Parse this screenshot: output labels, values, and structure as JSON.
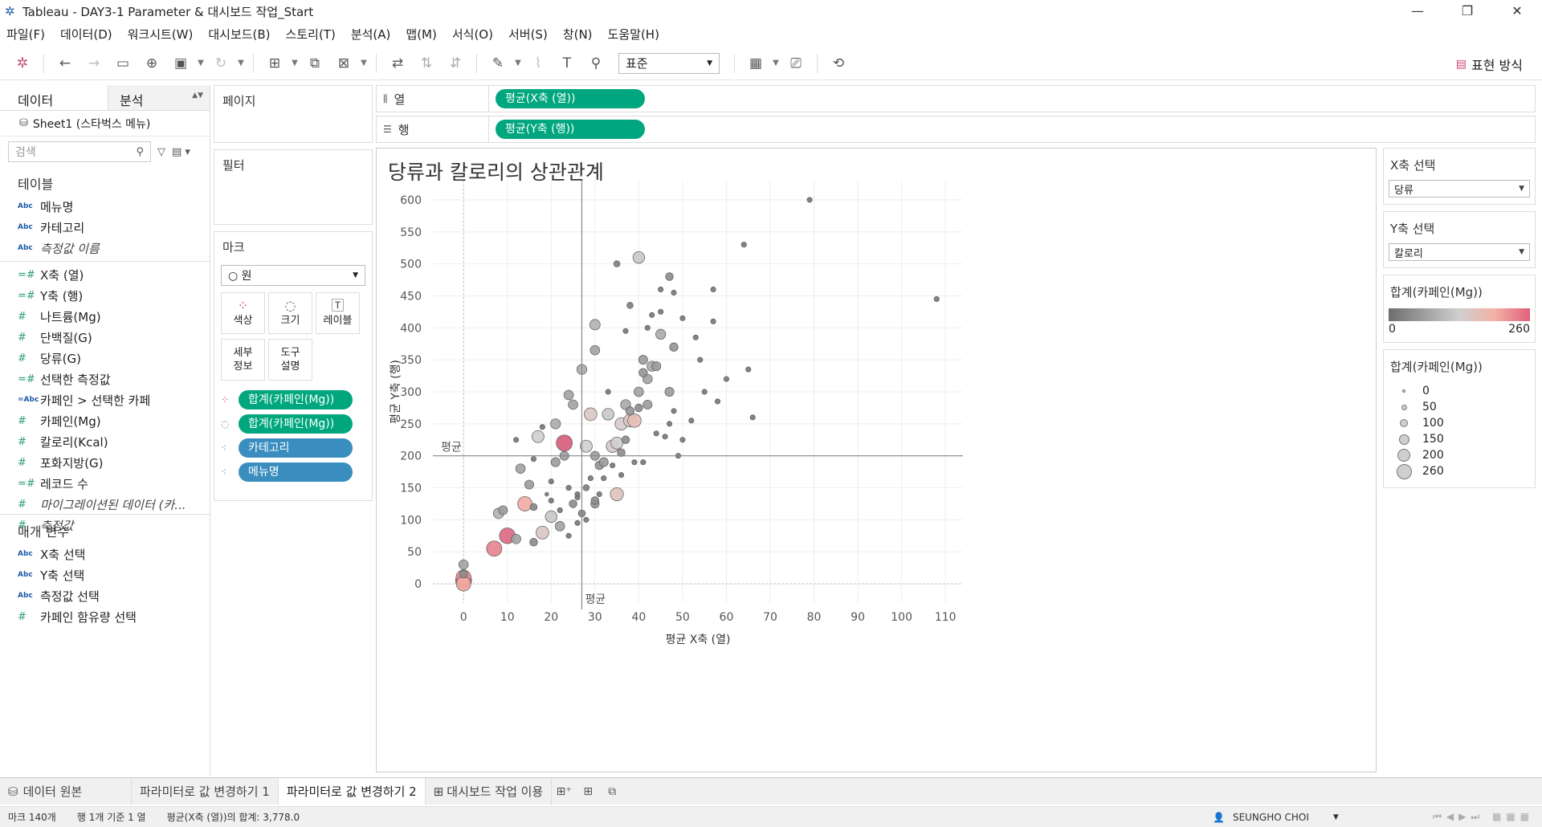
{
  "window": {
    "title": "Tableau - DAY3-1 Parameter & 대시보드 작업_Start"
  },
  "menu": [
    "파일(F)",
    "데이터(D)",
    "워크시트(W)",
    "대시보드(B)",
    "스토리(T)",
    "분석(A)",
    "맵(M)",
    "서식(O)",
    "서버(S)",
    "창(N)",
    "도움말(H)"
  ],
  "toolbar": {
    "view_size": "표준",
    "show_me": "표현 방식"
  },
  "left": {
    "tab_data": "데이터",
    "tab_analysis": "분석",
    "datasource": "Sheet1 (스타벅스 메뉴)",
    "search_placeholder": "검색",
    "tables_header": "테이블",
    "fields_dim": [
      {
        "icon": "Abc",
        "label": "메뉴명",
        "italic": false
      },
      {
        "icon": "Abc",
        "label": "카테고리",
        "italic": false
      },
      {
        "icon": "Abc",
        "label": "측정값 이름",
        "italic": true
      }
    ],
    "fields_meas": [
      {
        "icon": "=#",
        "label": "X축 (열)",
        "italic": false
      },
      {
        "icon": "=#",
        "label": "Y축 (행)",
        "italic": false
      },
      {
        "icon": "#",
        "label": "나트륨(Mg)",
        "italic": false
      },
      {
        "icon": "#",
        "label": "단백질(G)",
        "italic": false
      },
      {
        "icon": "#",
        "label": "당류(G)",
        "italic": false
      },
      {
        "icon": "=#",
        "label": "선택한 측정값",
        "italic": false
      },
      {
        "icon": "=Abc",
        "label": "카페인 > 선택한 카페",
        "italic": false
      },
      {
        "icon": "#",
        "label": "카페인(Mg)",
        "italic": false
      },
      {
        "icon": "#",
        "label": "칼로리(Kcal)",
        "italic": false
      },
      {
        "icon": "#",
        "label": "포화지방(G)",
        "italic": false
      },
      {
        "icon": "=#",
        "label": "레코드 수",
        "italic": false
      },
      {
        "icon": "#",
        "label": "마이그레이션된 데이터 (카...",
        "italic": true
      },
      {
        "icon": "#",
        "label": "측정값",
        "italic": true
      }
    ],
    "params_header": "매개 변수",
    "params": [
      {
        "icon": "Abc",
        "label": "X축 선택"
      },
      {
        "icon": "Abc",
        "label": "Y축 선택"
      },
      {
        "icon": "Abc",
        "label": "측정값 선택"
      },
      {
        "icon": "#",
        "label": "카페인 함유량 선택"
      }
    ]
  },
  "cards": {
    "pages": "페이지",
    "filters": "필터",
    "marks": "마크",
    "mark_type": "원",
    "mark_buttons": [
      {
        "icon": "color-icon",
        "label": "색상"
      },
      {
        "icon": "size-icon",
        "label": "크기"
      },
      {
        "icon": "label-icon",
        "label": "레이블"
      },
      {
        "icon": "",
        "label": "세부\n정보"
      },
      {
        "icon": "",
        "label": "도구\n설명"
      }
    ],
    "mark_pills": [
      {
        "icon": "color",
        "label": "합계(카페인(Mg))",
        "color": "green"
      },
      {
        "icon": "size",
        "label": "합계(카페인(Mg))",
        "color": "green"
      },
      {
        "icon": "detail",
        "label": "카테고리",
        "color": "blue"
      },
      {
        "icon": "detail",
        "label": "메뉴명",
        "color": "blue"
      }
    ]
  },
  "shelves": {
    "columns_label": "열",
    "columns_pill": "평균(X축 (열))",
    "rows_label": "행",
    "rows_pill": "평균(Y축 (행))"
  },
  "right": {
    "x_sel_title": "X축 선택",
    "x_sel_value": "당류",
    "y_sel_title": "Y축 선택",
    "y_sel_value": "칼로리",
    "color_legend_title": "합계(카페인(Mg))",
    "color_min": "0",
    "color_max": "260",
    "size_legend_title": "합계(카페인(Mg))",
    "size_legend": [
      "0",
      "50",
      "100",
      "150",
      "200",
      "260"
    ]
  },
  "chart_data": {
    "type": "scatter",
    "title": "당류과 칼로리의 상관관계",
    "xlabel": "평균 X축 (열)",
    "ylabel": "평균 Y축 (행)",
    "xlim": [
      -7,
      114
    ],
    "ylim": [
      -30,
      630
    ],
    "xticks": [
      0,
      10,
      20,
      30,
      40,
      50,
      60,
      70,
      80,
      90,
      100,
      110
    ],
    "yticks": [
      0,
      50,
      100,
      150,
      200,
      250,
      300,
      350,
      400,
      450,
      500,
      550,
      600
    ],
    "ref_x": 27,
    "ref_y": 200,
    "ref_label": "평균",
    "color_range": [
      0,
      260
    ],
    "points": [
      [
        0,
        5,
        260
      ],
      [
        0,
        10,
        220
      ],
      [
        0,
        0,
        200
      ],
      [
        0,
        30,
        70
      ],
      [
        0,
        15,
        40
      ],
      [
        7,
        55,
        230
      ],
      [
        8,
        110,
        90
      ],
      [
        9,
        115,
        60
      ],
      [
        10,
        75,
        250
      ],
      [
        12,
        70,
        70
      ],
      [
        13,
        180,
        70
      ],
      [
        14,
        125,
        200
      ],
      [
        15,
        155,
        60
      ],
      [
        16,
        120,
        30
      ],
      [
        16,
        65,
        40
      ],
      [
        18,
        80,
        150
      ],
      [
        17,
        230,
        130
      ],
      [
        19,
        140,
        5
      ],
      [
        20,
        105,
        120
      ],
      [
        21,
        250,
        80
      ],
      [
        21,
        190,
        60
      ],
      [
        22,
        90,
        70
      ],
      [
        23,
        200,
        60
      ],
      [
        23,
        220,
        260
      ],
      [
        24,
        295,
        70
      ],
      [
        25,
        125,
        40
      ],
      [
        25,
        280,
        70
      ],
      [
        27,
        335,
        80
      ],
      [
        28,
        215,
        130
      ],
      [
        29,
        265,
        150
      ],
      [
        30,
        405,
        90
      ],
      [
        30,
        365,
        70
      ],
      [
        30,
        200,
        60
      ],
      [
        31,
        185,
        50
      ],
      [
        32,
        190,
        60
      ],
      [
        33,
        265,
        120
      ],
      [
        34,
        215,
        140
      ],
      [
        35,
        220,
        130
      ],
      [
        35,
        140,
        160
      ],
      [
        36,
        250,
        140
      ],
      [
        38,
        255,
        150
      ],
      [
        39,
        255,
        170
      ],
      [
        40,
        510,
        120
      ],
      [
        37,
        280,
        80
      ],
      [
        38,
        270,
        50
      ],
      [
        40,
        300,
        70
      ],
      [
        41,
        350,
        60
      ],
      [
        42,
        320,
        70
      ],
      [
        43,
        340,
        80
      ],
      [
        44,
        340,
        60
      ],
      [
        45,
        390,
        80
      ],
      [
        47,
        480,
        40
      ],
      [
        47,
        300,
        60
      ],
      [
        48,
        370,
        50
      ],
      [
        41,
        330,
        50
      ],
      [
        42,
        280,
        60
      ],
      [
        40,
        275,
        40
      ],
      [
        37,
        225,
        40
      ],
      [
        36,
        205,
        40
      ],
      [
        30,
        125,
        50
      ],
      [
        30,
        130,
        40
      ],
      [
        28,
        150,
        20
      ],
      [
        27,
        110,
        30
      ],
      [
        26,
        135,
        10
      ],
      [
        35,
        500,
        20
      ],
      [
        48,
        455,
        10
      ],
      [
        38,
        435,
        20
      ],
      [
        42,
        400,
        10
      ],
      [
        45,
        425,
        10
      ],
      [
        48,
        270,
        10
      ],
      [
        50,
        225,
        10
      ],
      [
        53,
        385,
        10
      ],
      [
        54,
        350,
        10
      ],
      [
        57,
        410,
        10
      ],
      [
        57,
        460,
        10
      ],
      [
        60,
        320,
        10
      ],
      [
        64,
        530,
        10
      ],
      [
        65,
        335,
        10
      ],
      [
        66,
        260,
        10
      ],
      [
        79,
        600,
        10
      ],
      [
        108,
        445,
        10
      ],
      [
        18,
        245,
        10
      ],
      [
        20,
        160,
        10
      ],
      [
        24,
        150,
        10
      ],
      [
        26,
        140,
        10
      ],
      [
        28,
        100,
        10
      ],
      [
        31,
        140,
        10
      ],
      [
        32,
        165,
        10
      ],
      [
        33,
        300,
        10
      ],
      [
        37,
        395,
        10
      ],
      [
        41,
        190,
        10
      ],
      [
        43,
        420,
        10
      ],
      [
        46,
        230,
        10
      ],
      [
        47,
        250,
        10
      ],
      [
        49,
        200,
        10
      ],
      [
        55,
        300,
        10
      ],
      [
        12,
        225,
        10
      ],
      [
        16,
        195,
        10
      ],
      [
        20,
        130,
        10
      ],
      [
        22,
        115,
        10
      ],
      [
        24,
        75,
        10
      ],
      [
        26,
        95,
        10
      ],
      [
        29,
        165,
        10
      ],
      [
        34,
        185,
        10
      ],
      [
        36,
        170,
        10
      ],
      [
        39,
        190,
        10
      ],
      [
        44,
        235,
        10
      ],
      [
        45,
        460,
        10
      ],
      [
        50,
        415,
        10
      ],
      [
        52,
        255,
        10
      ],
      [
        58,
        285,
        10
      ]
    ]
  },
  "sheettabs": {
    "datasource": "데이터 원본",
    "tabs": [
      "파라미터로 값 변경하기 1",
      "파라미터로 값 변경하기 2",
      "대시보드 작업 이용"
    ]
  },
  "status": {
    "marks": "마크 140개",
    "rowscols": "행 1개 기준 1 열",
    "sum": "평균(X축 (열))의 합계: 3,778.0",
    "user": "SEUNGHO CHOI"
  }
}
